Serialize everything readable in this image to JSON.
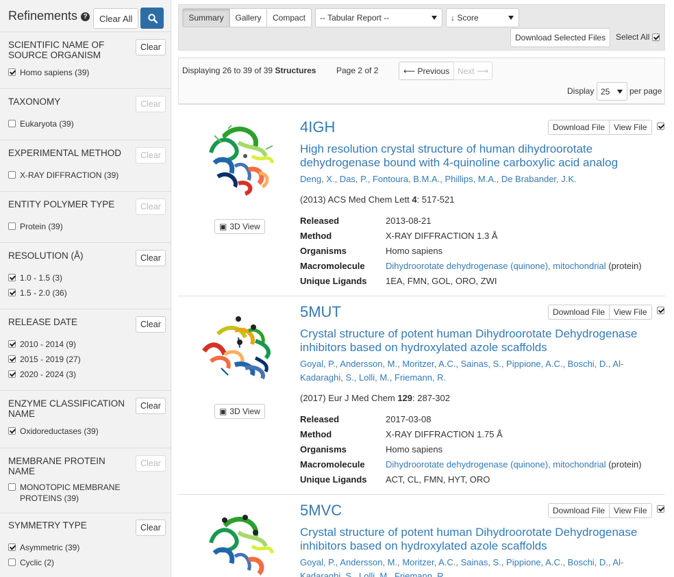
{
  "sidebar": {
    "title": "Refinements",
    "clear_all": "Clear All",
    "clear_label": "Clear",
    "facets": [
      {
        "title": "Scientific Name of Source Organism",
        "clear_enabled": true,
        "options": [
          {
            "label": "Homo sapiens (39)",
            "checked": true
          }
        ]
      },
      {
        "title": "Taxonomy",
        "clear_enabled": false,
        "options": [
          {
            "label": "Eukaryota (39)",
            "checked": false
          }
        ]
      },
      {
        "title": "Experimental Method",
        "clear_enabled": false,
        "options": [
          {
            "label": "X-RAY DIFFRACTION (39)",
            "checked": false
          }
        ]
      },
      {
        "title": "Entity Polymer Type",
        "clear_enabled": false,
        "options": [
          {
            "label": "Protein (39)",
            "checked": false
          }
        ]
      },
      {
        "title": "Resolution (Å)",
        "clear_enabled": true,
        "options": [
          {
            "label": "1.0 - 1.5 (3)",
            "checked": true
          },
          {
            "label": "1.5 - 2.0 (36)",
            "checked": true
          }
        ]
      },
      {
        "title": "Release Date",
        "clear_enabled": true,
        "options": [
          {
            "label": "2010 - 2014 (9)",
            "checked": true
          },
          {
            "label": "2015 - 2019 (27)",
            "checked": true
          },
          {
            "label": "2020 - 2024 (3)",
            "checked": true
          }
        ]
      },
      {
        "title": "Enzyme Classification Name",
        "clear_enabled": true,
        "options": [
          {
            "label": "Oxidoreductases (39)",
            "checked": true
          }
        ]
      },
      {
        "title": "Membrane Protein Name",
        "clear_enabled": false,
        "options": [
          {
            "label": "MONOTOPIC MEMBRANE PROTEINS (39)",
            "checked": false
          }
        ]
      },
      {
        "title": "Symmetry Type",
        "clear_enabled": true,
        "options": [
          {
            "label": "Asymmetric (39)",
            "checked": true
          },
          {
            "label": "Cyclic (2)",
            "checked": false
          }
        ]
      }
    ]
  },
  "toolbar": {
    "views": [
      "Summary",
      "Gallery",
      "Compact"
    ],
    "active_view": "Summary",
    "report_select": "-- Tabular Report --",
    "sort_select": "↓ Score",
    "download_selected": "Download Selected Files",
    "select_all": "Select All",
    "select_all_checked": true
  },
  "pager": {
    "displaying_prefix": "Displaying 26 to 39 of 39",
    "displaying_unit": "Structures",
    "page_text": "Page 2 of 2",
    "prev": "⟵ Previous",
    "next": "Next ⟶",
    "display_label": "Display",
    "per_page": "25",
    "per_page_suffix": "per page"
  },
  "result_labels": {
    "download_file": "Download File",
    "view_file": "View File",
    "view3d": "3D View",
    "released": "Released",
    "method": "Method",
    "organisms": "Organisms",
    "macromolecule": "Macromolecule",
    "ligands": "Unique Ligands"
  },
  "results": [
    {
      "id": "4IGH",
      "title": "High resolution crystal structure of human dihydroorotate dehydrogenase bound with 4-quinoline carboxylic acid analog",
      "authors": "Deng, X., Das, P., Fontoura, B.M.A., Phillips, M.A., De Brabander, J.K.",
      "cite_pre": "(2013) ACS Med Chem Lett ",
      "cite_vol": "4",
      "cite_post": ": 517-521",
      "released": "2013-08-21",
      "method": "X-RAY DIFFRACTION 1.3 Å",
      "organisms": "Homo sapiens",
      "macromolecule": "Dihydroorotate dehydrogenase (quinone), mitochondrial",
      "macromolecule_type": " (protein)",
      "ligands": "1EA, FMN, GOL, ORO, ZWI",
      "checked": true
    },
    {
      "id": "5MUT",
      "title": "Crystal structure of potent human Dihydroorotate Dehydrogenase inhibitors based on hydroxylated azole scaffolds",
      "authors": "Goyal, P., Andersson, M., Moritzer, A.C., Sainas, S., Pippione, A.C., Boschi, D., Al-Kadaraghi, S., Lolli, M., Friemann, R.",
      "cite_pre": "(2017) Eur J Med Chem ",
      "cite_vol": "129",
      "cite_post": ": 287-302",
      "released": "2017-03-08",
      "method": "X-RAY DIFFRACTION 1.75 Å",
      "organisms": "Homo sapiens",
      "macromolecule": "Dihydroorotate dehydrogenase (quinone), mitochondrial",
      "macromolecule_type": " (protein)",
      "ligands": "ACT, CL, FMN, HYT, ORO",
      "checked": true
    },
    {
      "id": "5MVC",
      "title": "Crystal structure of potent human Dihydroorotate Dehydrogenase inhibitors based on hydroxylated azole scaffolds",
      "authors": "Goyal, P., Andersson, M., Moritzer, A.C., Sainas, S., Pippione, A.C., Boschi, D., Al-Kadaraghi, S., Lolli, M., Friemann, R.",
      "checked": true
    }
  ]
}
